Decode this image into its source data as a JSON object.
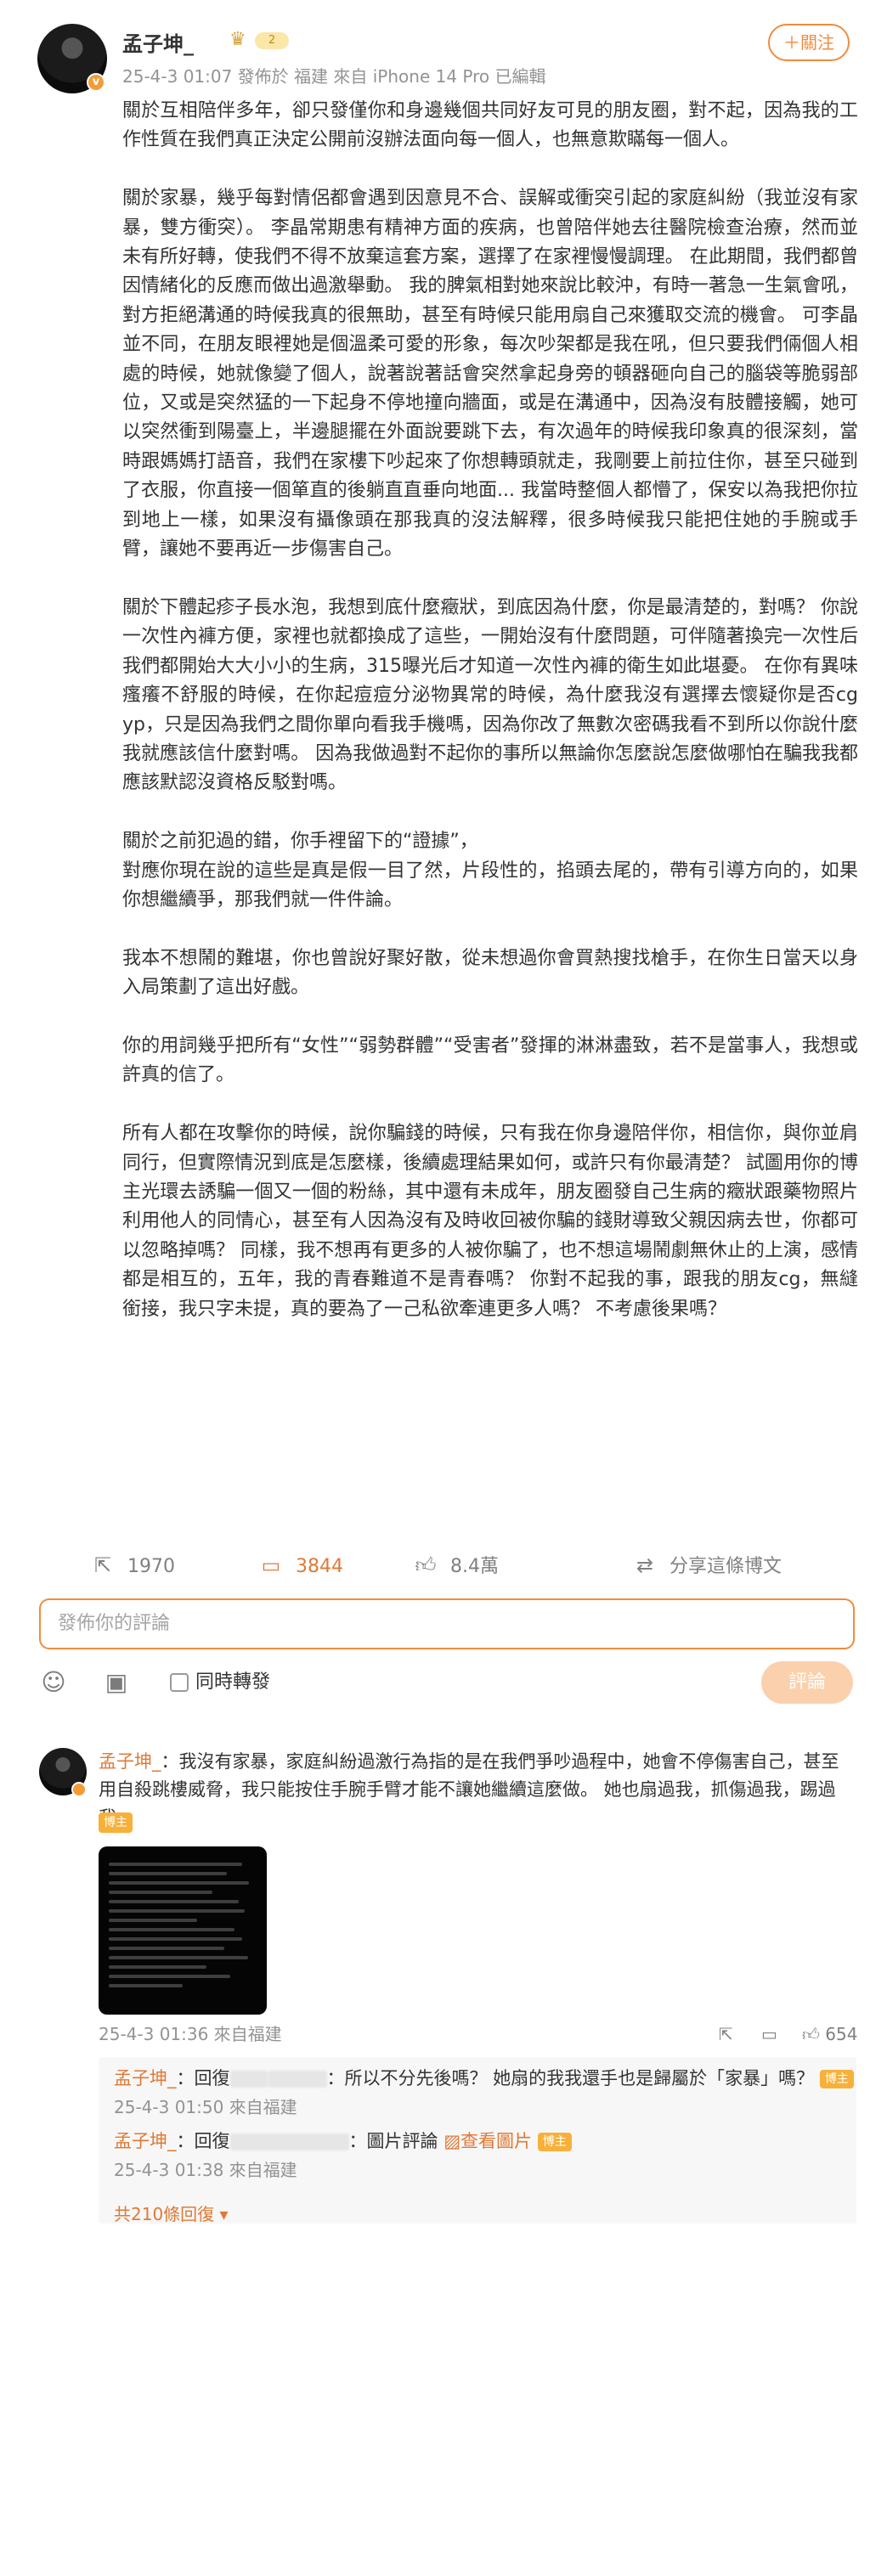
{
  "author": {
    "name": "孟子坤_",
    "level": "2",
    "meta": "25-4-3 01:07  發佈於 福建  來自 iPhone 14 Pro 已編輯",
    "follow_label": "＋關注"
  },
  "post": {
    "paragraphs": [
      "關於互相陪伴多年，卻只發僅你和身邊幾個共同好友可見的朋友圈，對不起，因為我的工作性質在我們真正決定公開前沒辦法面向每一個人，也無意欺瞞每一個人。",
      "關於家暴，幾乎每對情侶都會遇到因意見不合、誤解或衝突引起的家庭糾紛（我並沒有家暴，雙方衝突）。 李晶常期患有精神方面的疾病，也曾陪伴她去往醫院檢查治療，然而並未有所好轉，使我們不得不放棄這套方案，選擇了在家裡慢慢調理。 在此期間，我們都曾因情緒化的反應而做出過激舉動。 我的脾氣相對她來說比較沖，有時一著急一生氣會吼，對方拒絕溝通的時候我真的很無助，甚至有時候只能用扇自己來獲取交流的機會。 可李晶並不同，在朋友眼裡她是個溫柔可愛的形象，每次吵架都是我在吼，但只要我們倆個人相處的時候，她就像變了個人，說著說著話會突然拿起身旁的頓器砸向自己的腦袋等脆弱部位，又或是突然猛的一下起身不停地撞向牆面，或是在溝通中，因為沒有肢體接觸，她可以突然衝到陽臺上，半邊腿擺在外面說要跳下去，有次過年的時候我印象真的很深刻，當時跟媽媽打語音，我們在家樓下吵起來了你想轉頭就走，我剛要上前拉住你，甚至只碰到了衣服，你直接一個箪直的後躺直直垂向地面... 我當時整個人都懵了，保安以為我把你拉到地上一樣，如果沒有攝像頭在那我真的沒法解釋，很多時候我只能把住她的手腕或手臂，讓她不要再近一步傷害自己。",
      "關於下體起疹子長水泡，我想到底什麼癥狀，到底因為什麼，你是最清楚的，對嗎？ 你說一次性內褲方便，家裡也就都換成了這些，一開始沒有什麼問題，可伴隨著換完一次性后我們都開始大大小小的生病，315曝光后才知道一次性內褲的衛生如此堪憂。 在你有異味瘙癢不舒服的時候，在你起痘痘分泌物異常的時候，為什麼我沒有選擇去懷疑你是否cg yp，只是因為我們之間你單向看我手機嗎，因為你改了無數次密碼我看不到所以你說什麼我就應該信什麼對嗎。 因為我做過對不起你的事所以無論你怎麼說怎麼做哪怕在騙我我都應該默認沒資格反駁對嗎。",
      "關於之前犯過的錯，你手裡留下的“證據”，\n對應你現在說的這些是真是假一目了然，片段性的，掐頭去尾的，帶有引導方向的，如果你想繼續爭，那我們就一件件論。",
      "我本不想鬧的難堪，你也曾說好聚好散，從未想過你會買熱搜找槍手，在你生日當天以身入局策劃了這出好戲。",
      "你的用詞幾乎把所有“女性”“弱勢群體”“受害者”發揮的淋淋盡致，若不是當事人，我想或許真的信了。",
      "所有人都在攻擊你的時候，說你騙錢的時候，只有我在你身邊陪伴你，相信你，與你並肩同行，但實際情況到底是怎麼樣，後續處理結果如何，或許只有你最清楚？ 試圖用你的博主光環去誘騙一個又一個的粉絲，其中還有未成年，朋友圈發自己生病的癥狀跟藥物照片利用他人的同情心，甚至有人因為沒有及時收回被你騙的錢財導致父親因病去世，你都可以忽略掉嗎？ 同樣，我不想再有更多的人被你騙了，也不想這場鬧劇無休止的上演，感情都是相互的，五年，我的青春難道不是青春嗎？ 你對不起我的事，跟我的朋友cg，無縫銜接，我只字未提，真的要為了一己私欲牽連更多人嗎？ 不考慮後果嗎？"
    ]
  },
  "actions": {
    "repost_count": "1970",
    "comment_count": "3844",
    "like_count": "8.4萬",
    "share_label": "分享這條博文"
  },
  "composer": {
    "placeholder": "發佈你的評論",
    "repost_label": "同時轉發",
    "submit_label": "評論"
  },
  "comment": {
    "name": "孟子坤_",
    "text": "：我沒有家暴，家庭糾紛過激行為指的是在我們爭吵過程中，她會不停傷害自己，甚至用自殺跳樓威脅，我只能按住手腕手臂才能不讓她繼續這麼做。 她也扇過我，抓傷過我，踢過我。",
    "author_tag": "博主",
    "meta": "25-4-3 01:36 來自福建",
    "like_count": "654"
  },
  "replies": [
    {
      "name": "孟子坤_",
      "prefix": "：回復",
      "text": "：所以不分先後嗎？ 她扇的我我還手也是歸屬於「家暴」嗎？",
      "tag": "博主",
      "meta": "25-4-3 01:50 來自福建"
    },
    {
      "name": "孟子坤_",
      "prefix": "：回復",
      "text": "：圖片評論",
      "link": "查看圖片",
      "tag": "博主",
      "meta": "25-4-3 01:38 來自福建"
    }
  ],
  "more_replies": "共210條回復 ▾",
  "colors": {
    "accent": "#f08c3e",
    "username": "#e07936",
    "tag": "#f7b13a",
    "meta_gray": "#939393"
  },
  "icons": [
    "vip-crown-icon",
    "repost-icon",
    "comment-icon",
    "like-icon",
    "share-icon",
    "emoji-icon",
    "image-icon"
  ]
}
